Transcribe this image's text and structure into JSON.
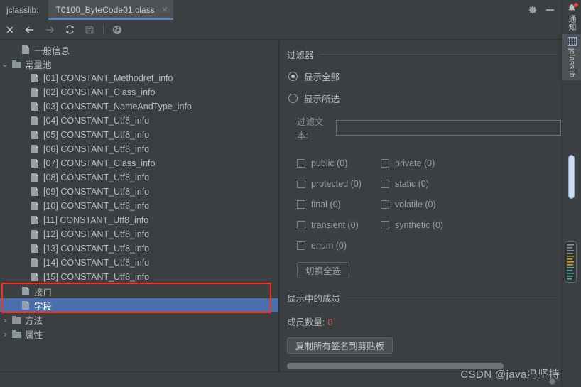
{
  "window": {
    "app_label": "jclasslib:",
    "tab_title": "T0100_ByteCode01.class",
    "tab_close": "✕",
    "settings_icon": "gear-icon",
    "minimize_icon": "minimize-icon"
  },
  "toolbar": {
    "buttons": [
      {
        "name": "close-button",
        "glyph": "✕",
        "enabled": true
      },
      {
        "name": "back-button",
        "glyph": "←",
        "enabled": true
      },
      {
        "name": "forward-button",
        "glyph": "→",
        "enabled": false
      },
      {
        "name": "reload-button",
        "glyph": "⟳",
        "enabled": true
      },
      {
        "name": "save-button",
        "glyph": "🖫",
        "enabled": false
      },
      {
        "name": "browse-button",
        "glyph": "🌐",
        "enabled": true
      }
    ]
  },
  "tree": {
    "items": [
      {
        "label": "一般信息",
        "icon": "document-icon",
        "indent": 1,
        "twisty": "",
        "selected": false
      },
      {
        "label": "常量池",
        "icon": "folder-icon",
        "indent": 0,
        "twisty": "v",
        "selected": false
      },
      {
        "label": "[01] CONSTANT_Methodref_info",
        "icon": "document-icon",
        "indent": 2,
        "twisty": "",
        "selected": false
      },
      {
        "label": "[02] CONSTANT_Class_info",
        "icon": "document-icon",
        "indent": 2,
        "twisty": "",
        "selected": false
      },
      {
        "label": "[03] CONSTANT_NameAndType_info",
        "icon": "document-icon",
        "indent": 2,
        "twisty": "",
        "selected": false
      },
      {
        "label": "[04] CONSTANT_Utf8_info",
        "icon": "document-icon",
        "indent": 2,
        "twisty": "",
        "selected": false
      },
      {
        "label": "[05] CONSTANT_Utf8_info",
        "icon": "document-icon",
        "indent": 2,
        "twisty": "",
        "selected": false
      },
      {
        "label": "[06] CONSTANT_Utf8_info",
        "icon": "document-icon",
        "indent": 2,
        "twisty": "",
        "selected": false
      },
      {
        "label": "[07] CONSTANT_Class_info",
        "icon": "document-icon",
        "indent": 2,
        "twisty": "",
        "selected": false
      },
      {
        "label": "[08] CONSTANT_Utf8_info",
        "icon": "document-icon",
        "indent": 2,
        "twisty": "",
        "selected": false
      },
      {
        "label": "[09] CONSTANT_Utf8_info",
        "icon": "document-icon",
        "indent": 2,
        "twisty": "",
        "selected": false
      },
      {
        "label": "[10] CONSTANT_Utf8_info",
        "icon": "document-icon",
        "indent": 2,
        "twisty": "",
        "selected": false
      },
      {
        "label": "[11] CONSTANT_Utf8_info",
        "icon": "document-icon",
        "indent": 2,
        "twisty": "",
        "selected": false
      },
      {
        "label": "[12] CONSTANT_Utf8_info",
        "icon": "document-icon",
        "indent": 2,
        "twisty": "",
        "selected": false
      },
      {
        "label": "[13] CONSTANT_Utf8_info",
        "icon": "document-icon",
        "indent": 2,
        "twisty": "",
        "selected": false
      },
      {
        "label": "[14] CONSTANT_Utf8_info",
        "icon": "document-icon",
        "indent": 2,
        "twisty": "",
        "selected": false
      },
      {
        "label": "[15] CONSTANT_Utf8_info",
        "icon": "document-icon",
        "indent": 2,
        "twisty": "",
        "selected": false
      },
      {
        "label": "接口",
        "icon": "document-icon",
        "indent": 1,
        "twisty": "",
        "selected": false
      },
      {
        "label": "字段",
        "icon": "document-icon",
        "indent": 1,
        "twisty": "",
        "selected": true
      },
      {
        "label": "方法",
        "icon": "folder-icon",
        "indent": 0,
        "twisty": ">",
        "selected": false
      },
      {
        "label": "属性",
        "icon": "folder-icon",
        "indent": 0,
        "twisty": ">",
        "selected": false
      }
    ],
    "annotation_color": "#ff2d16",
    "selection_color": "#4b6eaf"
  },
  "filter": {
    "section_title": "过滤器",
    "radios": [
      {
        "label": "显示全部",
        "checked": true
      },
      {
        "label": "显示所选",
        "checked": false
      }
    ],
    "filter_text_label": "过滤文本:",
    "filter_text_value": "",
    "filter_text_placeholder": "",
    "checkboxes": [
      {
        "label": "public (0)",
        "checked": false
      },
      {
        "label": "private (0)",
        "checked": false
      },
      {
        "label": "protected (0)",
        "checked": false
      },
      {
        "label": "static (0)",
        "checked": false
      },
      {
        "label": "final (0)",
        "checked": false
      },
      {
        "label": "volatile (0)",
        "checked": false
      },
      {
        "label": "transient (0)",
        "checked": false
      },
      {
        "label": "synthetic (0)",
        "checked": false
      },
      {
        "label": "enum (0)",
        "checked": false
      }
    ],
    "toggle_all_label": "切换全选"
  },
  "members": {
    "section_title": "显示中的成员",
    "count_label": "成员数量:",
    "count_value": "0",
    "count_color": "#d9534f",
    "copy_button_label": "复制所有签名到剪贴板"
  },
  "edge_strip": {
    "items": [
      {
        "label": "通知",
        "icon": "bell-icon",
        "active": false,
        "badge": true
      },
      {
        "label": "jclasslib",
        "icon": "grid-icon",
        "active": true,
        "badge": false
      }
    ]
  },
  "watermark": "CSDN @java冯坚持"
}
